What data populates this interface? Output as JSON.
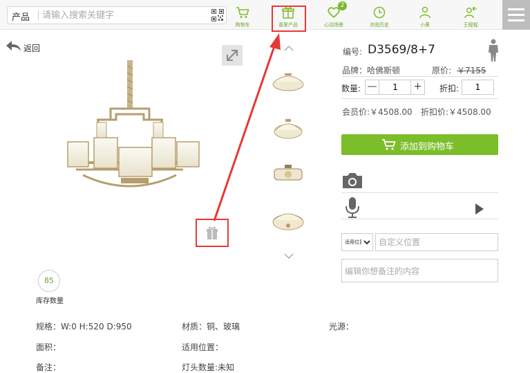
{
  "search": {
    "category": "产品",
    "placeholder": "请输入搜索关键字"
  },
  "nav": {
    "items": [
      {
        "label": "购物车",
        "icon": "cart-icon"
      },
      {
        "label": "喜爱产品",
        "icon": "gift-icon"
      },
      {
        "label": "心动场景",
        "icon": "heart-icon",
        "badge": "2"
      },
      {
        "label": "浏览历史",
        "icon": "clock-icon"
      },
      {
        "label": "小黄",
        "icon": "user-icon"
      },
      {
        "label": "王程程",
        "icon": "user-speaker-icon"
      }
    ]
  },
  "back_label": "返回",
  "stock": {
    "value": "85",
    "label": "库存数量"
  },
  "product": {
    "code_label": "编号:",
    "code": "D3569/8+7",
    "brand": "品牌：哈佛斯顿",
    "original_price_label": "原价:",
    "original_price": "￥7155",
    "qty_label": "数量:",
    "qty_minus": "—",
    "qty_plus": "+",
    "qty_value": "1",
    "discount_label": "折扣:",
    "discount_value": "1",
    "member_price": "会员价:￥4508.00",
    "discount_price": "折扣价:￥4508.00",
    "add_to_cart": "添加到购物车"
  },
  "position": {
    "select_value": "适用位置",
    "custom_placeholder": "自定义位置",
    "note_placeholder": "编辑你想备注的内容"
  },
  "specs": {
    "size": "规格：W:0 H:520 D:950",
    "material": "材质：铜、玻璃",
    "light_source": "光源：",
    "area": "面积：",
    "applicable": "适用位置：",
    "remarks": "备注：",
    "bulb_count": "灯头数量:未知"
  },
  "colors": {
    "accent": "#7cbd2a",
    "highlight": "#e53935"
  }
}
